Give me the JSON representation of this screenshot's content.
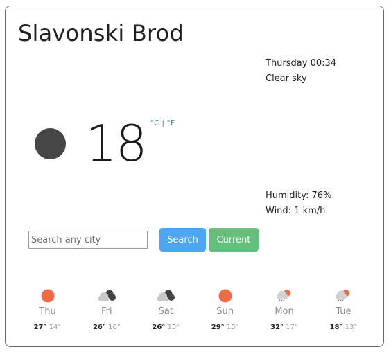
{
  "city": "Slavonski Brod",
  "datetime": "Thursday 00:34",
  "condition": "Clear sky",
  "temperature": "18",
  "units": {
    "celsius": "°C",
    "separator": "|",
    "fahrenheit": "°F"
  },
  "humidity": "Humidity: 76%",
  "wind": "Wind: 1 km/h",
  "search": {
    "placeholder": "Search any city",
    "value": ""
  },
  "buttons": {
    "search": "Search",
    "current": "Current"
  },
  "colors": {
    "moon": "#464646",
    "sun": "#f06b45",
    "search_button": "#4ea5f3",
    "current_button": "#63c07c",
    "unit_link": "#3d8bd1"
  },
  "forecast": [
    {
      "day": "Thu",
      "icon": "sun-icon",
      "max": "27°",
      "min": "14°"
    },
    {
      "day": "Fri",
      "icon": "cloudy-icon",
      "max": "26°",
      "min": "16°"
    },
    {
      "day": "Sat",
      "icon": "cloudy-icon",
      "max": "26°",
      "min": "15°"
    },
    {
      "day": "Sun",
      "icon": "sun-icon",
      "max": "29°",
      "min": "15°"
    },
    {
      "day": "Mon",
      "icon": "rain-sun-icon",
      "max": "32°",
      "min": "17°"
    },
    {
      "day": "Tue",
      "icon": "rain-sun-icon",
      "max": "18°",
      "min": "13°"
    }
  ]
}
